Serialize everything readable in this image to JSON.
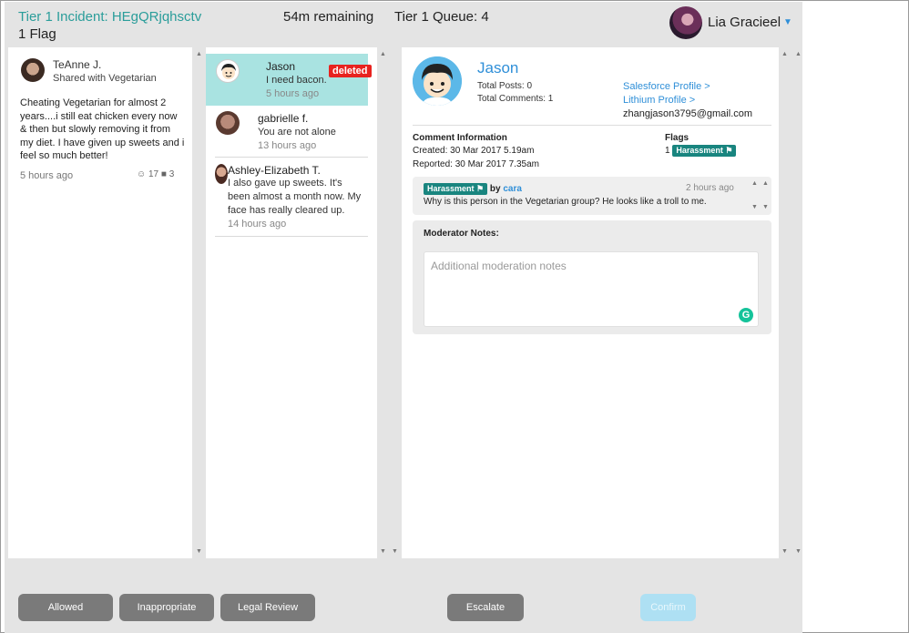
{
  "header": {
    "incident_title": "Tier 1 Incident: HEgQRjqhsctv",
    "flag_count": "1 Flag",
    "time_remaining": "54m remaining",
    "queue": "Tier 1 Queue: 4",
    "user_name": "Lia Gracieel"
  },
  "post": {
    "author": "TeAnne J.",
    "shared_with": "Shared with Vegetarian",
    "body": "Cheating Vegetarian for almost 2 years....i still eat chicken every now & then but slowly removing it from my diet. I have given up sweets and i feel so much better!",
    "time": "5 hours ago",
    "reactions": "17",
    "comments": "3"
  },
  "comments": [
    {
      "name": "Jason",
      "text": "I need bacon.",
      "time": "5 hours ago",
      "badge": "deleted"
    },
    {
      "name": "gabrielle f.",
      "text": "You are not alone",
      "time": "13 hours ago"
    },
    {
      "name": "Ashley-Elizabeth T.",
      "text": "I also gave up sweets. It's been almost a month now. My face has really cleared up.",
      "time": "14 hours ago"
    }
  ],
  "detail": {
    "name": "Jason",
    "total_posts": "Total Posts: 0",
    "total_comments": "Total Comments: 1",
    "salesforce_link": "Salesforce Profile >",
    "lithium_link": "Lithium Profile >",
    "email": "zhangjason3795@gmail.com",
    "comment_info_label": "Comment Information",
    "created": "Created:   30 Mar 2017 5.19am",
    "reported": "Reported: 30 Mar 2017 7.35am",
    "flags_label": "Flags",
    "flags_count": "1",
    "flag_type": "Harassment",
    "flag_by_label": "by",
    "flag_user": "cara",
    "flag_time": "2 hours ago",
    "flag_text": "Why is this person in the Vegetarian group? He looks like a troll to me.",
    "notes_label": "Moderator Notes:",
    "notes_placeholder": "Additional moderation notes"
  },
  "actions": {
    "allowed": "Allowed",
    "inappropriate": "Inappropriate",
    "legal_review": "Legal Review",
    "escalate": "Escalate",
    "confirm": "Confirm"
  },
  "colors": {
    "accent": "#2a9d9a",
    "link": "#2f8fd8",
    "selected_row": "#a9e3e1",
    "deleted_badge": "#e8231f",
    "flag_badge": "#19857f",
    "button": "#7a7a7a",
    "confirm_disabled": "#aee0f3"
  }
}
